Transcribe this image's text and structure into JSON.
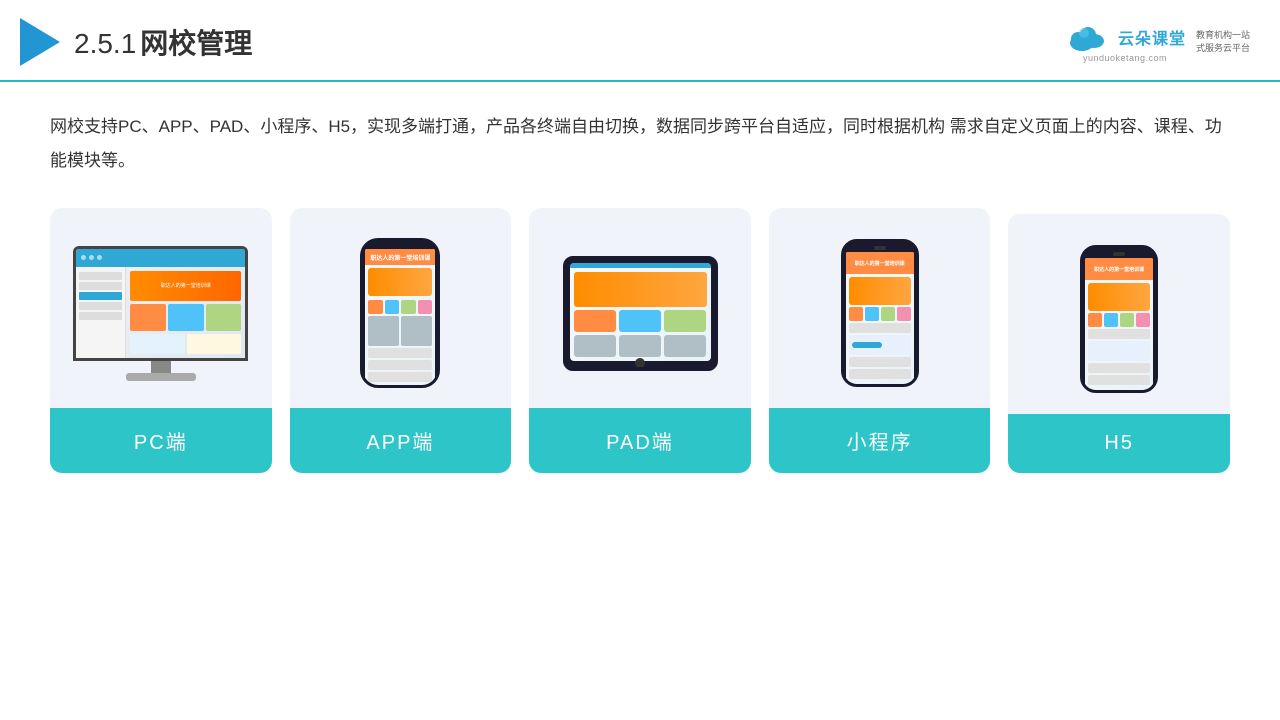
{
  "header": {
    "title": "网校管理",
    "section_number": "2.5.1",
    "brand": {
      "name": "云朵课堂",
      "url": "yunduoketang.com",
      "slogan": "教育机构一站\n式服务云平台"
    }
  },
  "description": "网校支持PC、APP、PAD、小程序、H5，实现多端打通，产品各终端自由切换，数据同步跨平台自适应，同时根据机构\n需求自定义页面上的内容、课程、功能模块等。",
  "cards": [
    {
      "label": "PC端",
      "type": "pc"
    },
    {
      "label": "APP端",
      "type": "phone"
    },
    {
      "label": "PAD端",
      "type": "tablet"
    },
    {
      "label": "小程序",
      "type": "mini_phone"
    },
    {
      "label": "H5",
      "type": "mini_phone2"
    }
  ],
  "colors": {
    "teal": "#2ec5c8",
    "blue": "#2196d3",
    "brand_blue": "#2fa8d5"
  }
}
